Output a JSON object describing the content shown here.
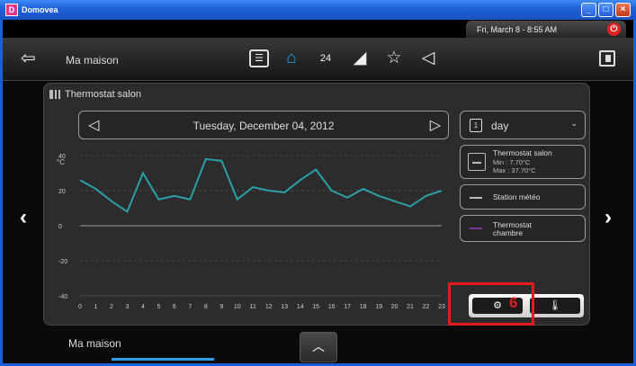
{
  "window": {
    "title": "Domovea"
  },
  "status": {
    "datetime": "Fri, March 8 - 8:55 AM"
  },
  "navbar": {
    "title": "Ma maison",
    "icons": [
      "list-icon",
      "home-icon",
      "timer-24-icon",
      "camera-icon",
      "star-icon",
      "speaker-icon"
    ]
  },
  "panel": {
    "title": "Thermostat salon",
    "date": "Tuesday, December 04, 2012",
    "period": "day",
    "calendar_day": "1",
    "settings_badge": "6",
    "legend": [
      {
        "name": "Thermostat salon",
        "min": "Min : 7.70°C",
        "max": "Max : 37.70°C",
        "color": "#ffffff"
      },
      {
        "name": "Station météo",
        "color": "#7a7a7a"
      },
      {
        "name": "Thermostat chambre",
        "color": "#7a3a9a"
      }
    ]
  },
  "chart_data": {
    "type": "line",
    "ylabel": "°C",
    "ylim": [
      -40,
      40
    ],
    "yticks": [
      40,
      20,
      0,
      -20,
      -40
    ],
    "x": [
      0,
      1,
      2,
      3,
      4,
      5,
      6,
      7,
      8,
      9,
      10,
      11,
      12,
      13,
      14,
      15,
      16,
      17,
      18,
      19,
      20,
      21,
      22,
      23
    ],
    "series": [
      {
        "name": "Thermostat salon",
        "color": "#2aa0a8",
        "values": [
          26,
          21,
          14,
          8,
          30,
          15,
          17,
          15,
          38,
          37,
          15,
          22,
          20,
          19,
          26,
          32,
          20,
          16,
          21,
          17,
          14,
          11,
          17,
          20
        ]
      }
    ]
  },
  "footer": {
    "label": "Ma maison"
  }
}
